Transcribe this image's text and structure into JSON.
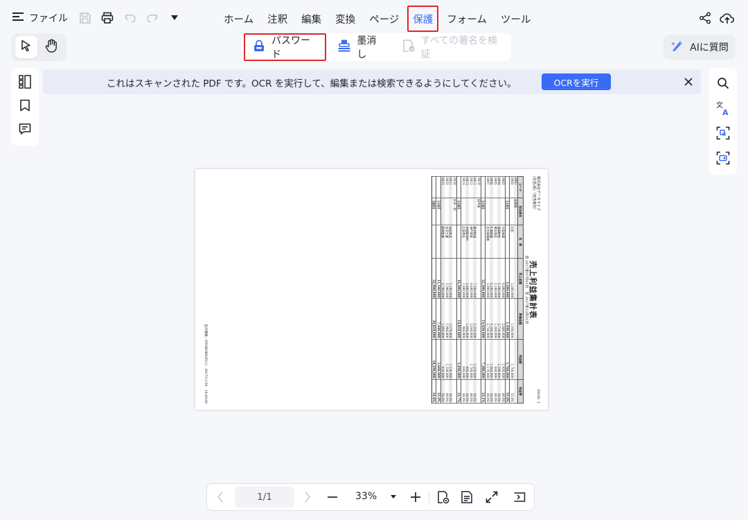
{
  "toolbar": {
    "file_label": "ファイル",
    "icons": [
      "menu-icon",
      "save-icon",
      "print-icon",
      "undo-icon",
      "redo-icon",
      "dropdown-icon"
    ]
  },
  "nav": {
    "items": [
      {
        "label": "ホーム",
        "active": false
      },
      {
        "label": "注釈",
        "active": false
      },
      {
        "label": "編集",
        "active": false
      },
      {
        "label": "変換",
        "active": false
      },
      {
        "label": "ページ",
        "active": false
      },
      {
        "label": "保護",
        "active": true
      },
      {
        "label": "フォーム",
        "active": false
      },
      {
        "label": "ツール",
        "active": false
      }
    ]
  },
  "protect_tools": {
    "password": "パスワード",
    "redact": "墨消し",
    "verify_signatures": "すべての署名を検証"
  },
  "ai_button": "AIに質問",
  "banner": {
    "message": "これはスキャンされた PDF です。OCR を実行して、編集または検索できるようにしてください。",
    "ocr_button": "OCRを実行"
  },
  "document": {
    "company": "株式会社データライフ",
    "company_sub": "(社名(仮)（担当者別）",
    "title": "売上利益集計表",
    "period": "自 2017年07月01日　至 2017年12月31日",
    "page_no": "PAGE: 1",
    "columns": [
      "コード",
      "担当者名",
      "名　称",
      "売上金額",
      "原価金額",
      "利益額",
      "利益率"
    ],
    "rows": [
      {
        "code": "0001",
        "staff": "佐藤健",
        "name": "",
        "sales": "",
        "cost": "",
        "profit": "",
        "rate": "",
        "type": "head"
      },
      {
        "code": "0002",
        "staff": "",
        "name": "石田",
        "sales": "3,200,000",
        "cost": "1,440,000",
        "profit": "1,760,000",
        "rate": "55.0%"
      },
      {
        "code": "",
        "staff": "【小計】",
        "name": "",
        "sales": "3,200,000",
        "cost": "1,440,000",
        "profit": "1,760,000",
        "rate": "55.0%",
        "type": "sub"
      },
      {
        "code": "0003",
        "staff": "",
        "name": "大阪商事",
        "sales": "4,800,000",
        "cost": "2,880,000",
        "profit": "1,920,000",
        "rate": "40.0%"
      },
      {
        "code": "0004",
        "staff": "",
        "name": "福岡物産",
        "sales": "5,300,000",
        "cost": "3,710,000",
        "profit": "1,590,000",
        "rate": "30.0%"
      },
      {
        "code": "0005",
        "staff": "",
        "name": "横浜商会",
        "sales": "2,100,000",
        "cost": "1,260,000",
        "profit": "840,000",
        "rate": "40.0%"
      },
      {
        "code": "0006",
        "staff": "",
        "name": "札幌興業",
        "sales": "6,200,000",
        "cost": "4,340,000",
        "profit": "1,860,000",
        "rate": "30.0%"
      },
      {
        "code": "0007",
        "staff": "",
        "name": "名古屋電機",
        "sales": "3,900,000",
        "cost": "2,730,000",
        "profit": "1,170,000",
        "rate": "30.0%"
      },
      {
        "code": "",
        "staff": "【小計】",
        "name": "",
        "sales": "22,300,000",
        "cost": "14,920,000",
        "profit": "7,380,000",
        "rate": "33.1%",
        "type": "sub"
      },
      {
        "code": "0010",
        "staff": "田中誠",
        "name": "",
        "sales": "",
        "cost": "",
        "profit": "",
        "rate": "",
        "type": "head"
      },
      {
        "code": "0011",
        "staff": "",
        "name": "東京物流",
        "sales": "7,500,000",
        "cost": "5,250,000",
        "profit": "2,250,000",
        "rate": "30.0%"
      },
      {
        "code": "0012",
        "staff": "",
        "name": "神戸貿易",
        "sales": "4,400,000",
        "cost": "2,640,000",
        "profit": "1,760,000",
        "rate": "40.0%"
      },
      {
        "code": "0013",
        "staff": "",
        "name": "京都製作所",
        "sales": "2,800,000",
        "cost": "1,960,000",
        "profit": "840,000",
        "rate": "30.0%"
      },
      {
        "code": "0014",
        "staff": "",
        "name": "広島商店",
        "sales": "1,600,000",
        "cost": "960,000",
        "profit": "640,000",
        "rate": "40.0%"
      },
      {
        "code": "",
        "staff": "【小計】",
        "name": "",
        "sales": "16,300,000",
        "cost": "10,810,000",
        "profit": "5,490,000",
        "rate": "33.7%",
        "type": "sub"
      },
      {
        "code": "0020",
        "staff": "鈴木一郎",
        "name": "",
        "sales": "",
        "cost": "",
        "profit": "",
        "rate": "",
        "type": "head"
      },
      {
        "code": "0021",
        "staff": "",
        "name": "仙台食品",
        "sales": "5,100,000",
        "cost": "3,570,000",
        "profit": "1,530,000",
        "rate": "30.0%"
      },
      {
        "code": "0022",
        "staff": "",
        "name": "金沢工業",
        "sales": "3,300,000",
        "cost": "1,980,000",
        "profit": "1,320,000",
        "rate": "40.0%"
      },
      {
        "code": "0023",
        "staff": "",
        "name": "静岡産業",
        "sales": "2,700,000",
        "cost": "1,890,000",
        "profit": "810,000",
        "rate": "30.0%"
      },
      {
        "code": "",
        "staff": "【小計】",
        "name": "",
        "sales": "11,100,000",
        "cost": "7,440,000",
        "profit": "3,660,000",
        "rate": "33.0%",
        "type": "sub"
      },
      {
        "code": "",
        "staff": "【合計】",
        "name": "",
        "sales": "52,900,000",
        "cost": "34,610,000",
        "profit": "18,290,000",
        "rate": "34.6%",
        "type": "total"
      }
    ],
    "footer": "出力情報：OTOBOKE(PC1)　2017/11/30　10:40:00"
  },
  "bottom_bar": {
    "page_indicator": "1/1",
    "zoom": "33%"
  }
}
